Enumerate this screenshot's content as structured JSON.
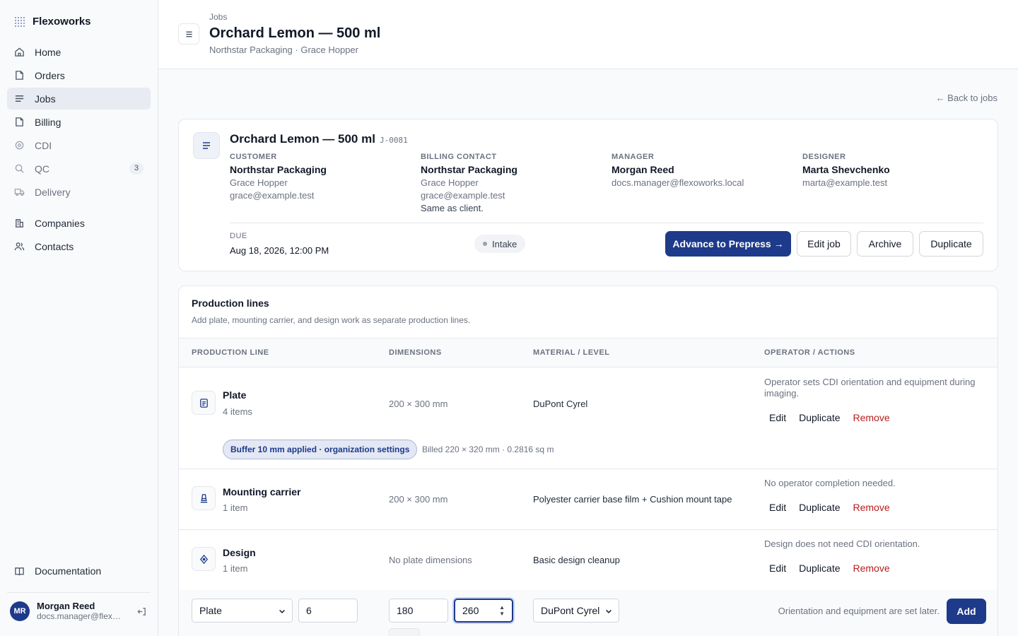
{
  "app": {
    "name": "Flexoworks"
  },
  "sidebar": {
    "items": [
      {
        "label": "Home",
        "icon": "home-icon"
      },
      {
        "label": "Orders",
        "icon": "folder-icon"
      },
      {
        "label": "Jobs",
        "icon": "list-icon",
        "active": true
      },
      {
        "label": "Billing",
        "icon": "folder-icon"
      },
      {
        "label": "CDI",
        "icon": "target-icon"
      },
      {
        "label": "QC",
        "icon": "search-icon",
        "badge": "3"
      },
      {
        "label": "Delivery",
        "icon": "truck-icon"
      },
      {
        "label": "Companies",
        "icon": "building-icon"
      },
      {
        "label": "Contacts",
        "icon": "users-icon"
      }
    ],
    "documentation": "Documentation",
    "user": {
      "initials": "MR",
      "name": "Morgan Reed",
      "email": "docs.manager@flexoworks.local"
    }
  },
  "header": {
    "breadcrumb": "Jobs",
    "title": "Orchard Lemon — 500 ml",
    "subtitle": "Northstar Packaging · Grace Hopper"
  },
  "back_link": "← Back to jobs",
  "job": {
    "title": "Orchard Lemon — 500 ml",
    "code": "J-0081",
    "customer": {
      "label": "CUSTOMER",
      "name": "Northstar Packaging",
      "contact": "Grace Hopper",
      "email": "grace@example.test"
    },
    "billing": {
      "label": "BILLING CONTACT",
      "name": "Northstar Packaging",
      "contact": "Grace Hopper",
      "email": "grace@example.test",
      "note": "Same as client."
    },
    "manager": {
      "label": "MANAGER",
      "name": "Morgan Reed",
      "email": "docs.manager@flexoworks.local"
    },
    "designer": {
      "label": "DESIGNER",
      "name": "Marta Shevchenko",
      "email": "marta@example.test"
    },
    "due_label": "DUE",
    "due": "Aug 18, 2026, 12:00 PM",
    "status": "Intake",
    "actions": {
      "advance": "Advance to Prepress →",
      "edit": "Edit job",
      "archive": "Archive",
      "duplicate": "Duplicate"
    }
  },
  "production": {
    "title": "Production lines",
    "subtitle": "Add plate, mounting carrier, and design work as separate production lines.",
    "columns": [
      "PRODUCTION LINE",
      "DIMENSIONS",
      "MATERIAL / LEVEL",
      "OPERATOR / ACTIONS"
    ],
    "rows": [
      {
        "name": "Plate",
        "count": "4 items",
        "dimensions": "200 × 300 mm",
        "material": "DuPont Cyrel",
        "note": "Operator sets CDI orientation and equipment during imaging.",
        "buffer": "Buffer 10 mm applied · organization settings",
        "billed": "Billed 220 × 320 mm · 0.2816 sq m"
      },
      {
        "name": "Mounting carrier",
        "count": "1 item",
        "dimensions": "200 × 300 mm",
        "material": "Polyester carrier base film + Cushion mount tape",
        "note": "No operator completion needed."
      },
      {
        "name": "Design",
        "count": "1 item",
        "dimensions": "No plate dimensions",
        "material": "Basic design cleanup",
        "note": "Design does not need CDI orientation."
      }
    ],
    "row_actions": {
      "edit": "Edit",
      "duplicate": "Duplicate",
      "remove": "Remove"
    },
    "add_form": {
      "type": "Plate",
      "quantity": "6",
      "width": "180",
      "height": "260",
      "material": "DuPont Cyrel",
      "note": "Orientation and equipment are set later.",
      "add": "Add"
    }
  }
}
